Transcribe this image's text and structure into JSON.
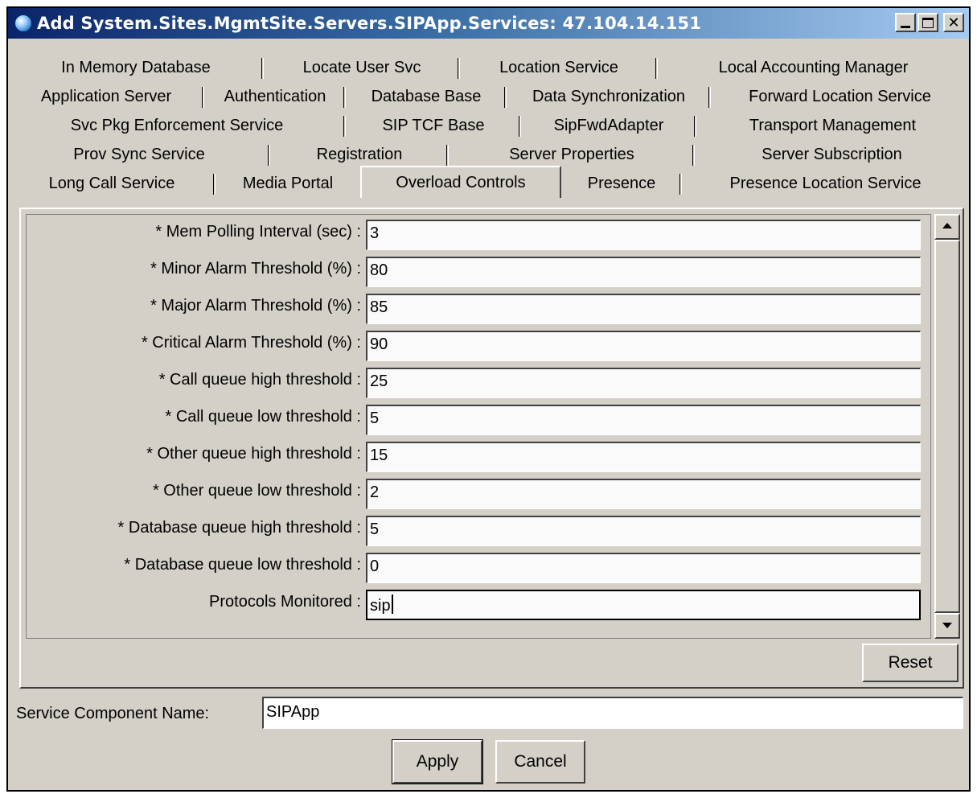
{
  "window": {
    "title": "Add System.Sites.MgmtSite.Servers.SIPApp.Services: 47.104.14.151",
    "icon": "globe-icon",
    "controls": [
      "minimize",
      "maximize",
      "close"
    ]
  },
  "tabs": {
    "row1": [
      "In Memory Database",
      "Locate User Svc",
      "Location Service",
      "Local Accounting Manager"
    ],
    "row2": [
      "Application Server",
      "Authentication",
      "Database Base",
      "Data Synchronization",
      "Forward Location Service"
    ],
    "row3": [
      "Svc Pkg Enforcement Service",
      "SIP TCF Base",
      "SipFwdAdapter",
      "Transport Management"
    ],
    "row4": [
      "Prov Sync Service",
      "Registration",
      "Server Properties",
      "Server Subscription"
    ],
    "row5": [
      "Long Call Service",
      "Media Portal",
      "Overload Controls",
      "Presence",
      "Presence Location Service"
    ],
    "selected": "Overload Controls"
  },
  "form": {
    "fields": [
      {
        "label": "* Mem Polling Interval (sec) :",
        "value": "3"
      },
      {
        "label": "* Minor Alarm Threshold (%) :",
        "value": "80"
      },
      {
        "label": "* Major Alarm Threshold (%) :",
        "value": "85"
      },
      {
        "label": "* Critical Alarm Threshold (%) :",
        "value": "90"
      },
      {
        "label": "* Call queue high threshold :",
        "value": "25"
      },
      {
        "label": "* Call queue low threshold :",
        "value": "5"
      },
      {
        "label": "* Other queue high threshold :",
        "value": "15"
      },
      {
        "label": "* Other queue low threshold :",
        "value": "2"
      },
      {
        "label": "* Database queue high threshold :",
        "value": "5"
      },
      {
        "label": "* Database queue low threshold :",
        "value": "0"
      },
      {
        "label": "Protocols Monitored :",
        "value": "sip"
      }
    ],
    "reset_label": "Reset"
  },
  "service_component": {
    "label": "Service Component Name:",
    "value": "SIPApp"
  },
  "actions": {
    "apply_label": "Apply",
    "cancel_label": "Cancel"
  },
  "colors": {
    "title_start": "#0a246a",
    "title_end": "#a6caf0",
    "face": "#d4d0c8"
  }
}
